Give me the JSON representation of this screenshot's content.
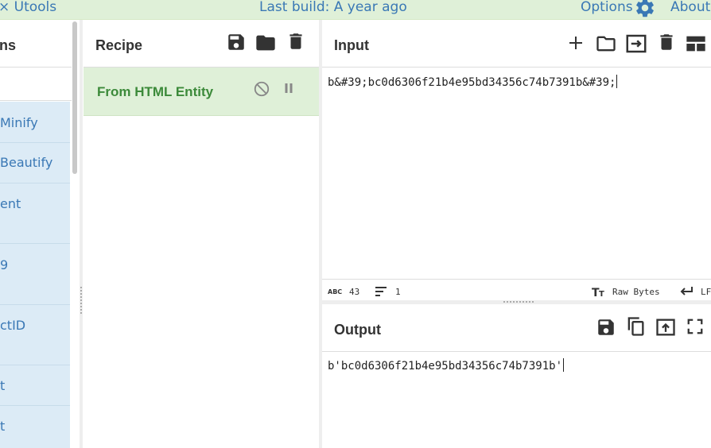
{
  "topbar": {
    "left_text": "× Utools",
    "build_text": "Last build: A year ago",
    "options_label": "Options",
    "about_label": "About"
  },
  "operations": {
    "title": "ns",
    "items": [
      "Minify",
      "Beautify",
      "ent",
      "9",
      "ctID",
      "t",
      "t"
    ]
  },
  "recipe": {
    "title": "Recipe",
    "items": [
      {
        "name": "From HTML Entity"
      }
    ]
  },
  "input": {
    "title": "Input",
    "value": "b&#39;bc0d6306f21b4e95bd34356c74b7391b&#39;",
    "status": {
      "length": "43",
      "lines": "1",
      "format": "Raw Bytes",
      "eol": "LF"
    }
  },
  "output": {
    "title": "Output",
    "value": "b'bc0d6306f21b4e95bd34356c74b7391b'"
  },
  "colors": {
    "accent_blue": "#3a78b5",
    "banner_green": "#dff0d8",
    "recipe_green": "#3c8a3a",
    "ops_blue": "#dcebf6"
  }
}
